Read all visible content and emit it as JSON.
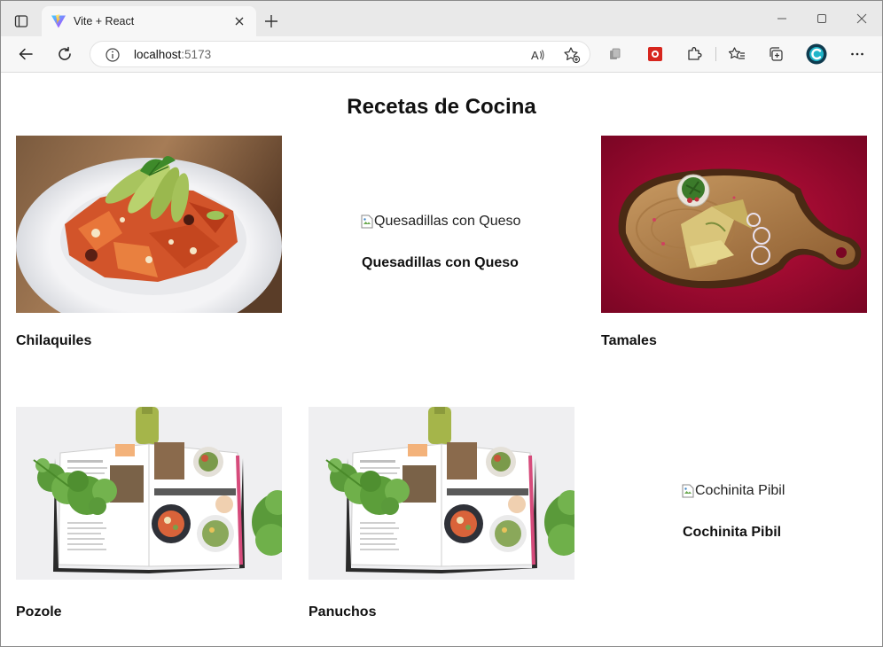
{
  "browser": {
    "tab": {
      "title": "Vite + React",
      "favicon": "vite-logo"
    },
    "address_bar": {
      "host": "localhost",
      "port": ":5173"
    },
    "icons": {
      "tab_actions": "tab-actions-icon",
      "close_tab": "close-icon",
      "new_tab": "plus-icon",
      "back": "back-arrow-icon",
      "refresh": "refresh-icon",
      "info": "info-icon",
      "read_aloud": "read-aloud-icon",
      "favorite": "add-favorite-icon",
      "ext1": "extension-icon",
      "ext2": "extension-red-icon",
      "extensions": "puzzle-icon",
      "favorites": "favorites-icon",
      "collections": "collections-icon",
      "profile": "profile-avatar-icon",
      "more": "more-icon"
    },
    "colors": {
      "tab_strip": "#e9e9e9",
      "toolbar": "#f7f7f7"
    }
  },
  "page": {
    "title": "Recetas de Cocina",
    "recipes": [
      {
        "name": "Chilaquiles",
        "image": "photo",
        "image_alt": "Chilaquiles"
      },
      {
        "name": "Quesadillas con Queso",
        "image": "broken",
        "image_alt": "Quesadillas con Queso"
      },
      {
        "name": "Tamales",
        "image": "photo",
        "image_alt": "Tamales"
      },
      {
        "name": "Pozole",
        "image": "photo",
        "image_alt": "Pozole"
      },
      {
        "name": "Panuchos",
        "image": "photo",
        "image_alt": "Panuchos"
      },
      {
        "name": "Cochinita Pibil",
        "image": "broken",
        "image_alt": "Cochinita Pibil"
      }
    ]
  }
}
